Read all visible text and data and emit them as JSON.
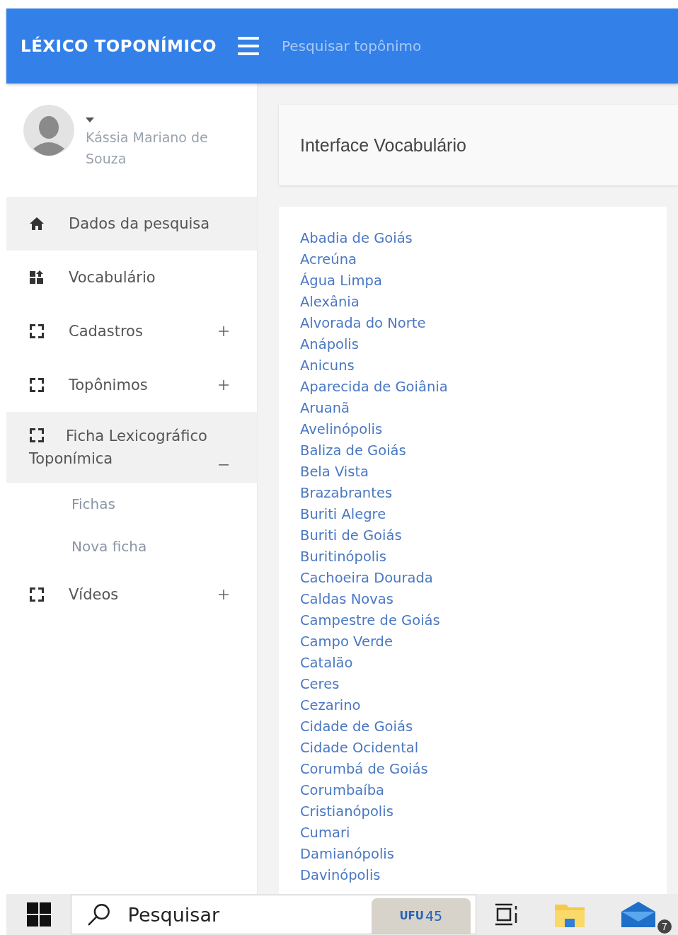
{
  "header": {
    "title": "LÉXICO TOPONÍMICO",
    "search": {
      "placeholder": "Pesquisar topônimo"
    }
  },
  "user": {
    "name": "Kássia Mariano de Souza"
  },
  "sidebar": {
    "items": [
      {
        "label": "Dados da pesquisa",
        "kind": "home",
        "selected": true
      },
      {
        "label": "Vocabulário",
        "kind": "tiles",
        "selected": false
      },
      {
        "label": "Cadastros",
        "kind": "group",
        "selected": false,
        "expanded": false
      },
      {
        "label": "Topônimos",
        "kind": "group",
        "selected": false,
        "expanded": false
      },
      {
        "label": "Ficha Lexicográfico Toponímica",
        "kind": "group",
        "selected": true,
        "expanded": true,
        "children": [
          {
            "label": "Fichas"
          },
          {
            "label": "Nova ficha"
          }
        ]
      },
      {
        "label": "Vídeos",
        "kind": "group",
        "selected": false,
        "expanded": false
      }
    ]
  },
  "page": {
    "title": "Interface Vocabulário"
  },
  "places": [
    "Abadia de Goiás",
    "Acreúna",
    "Água Limpa",
    "Alexânia",
    "Alvorada do Norte",
    "Anápolis",
    "Anicuns",
    "Aparecida de Goiânia",
    "Aruanã",
    "Avelinópolis",
    "Baliza de Goiás",
    "Bela Vista",
    "Brazabrantes",
    "Buriti Alegre",
    "Buriti de Goiás",
    "Buritinópolis",
    "Cachoeira Dourada",
    "Caldas Novas",
    "Campestre de Goiás",
    "Campo Verde",
    "Catalão",
    "Ceres",
    "Cezarino",
    "Cidade de Goiás",
    "Cidade Ocidental",
    "Corumbá de Goiás",
    "Corumbaíba",
    "Cristianópolis",
    "Cumari",
    "Damianópolis",
    "Davinópolis"
  ],
  "taskbar": {
    "search": {
      "placeholder": "Pesquisar"
    },
    "logo_text": "UFU",
    "logo_number": "45",
    "mail_count": "7"
  }
}
